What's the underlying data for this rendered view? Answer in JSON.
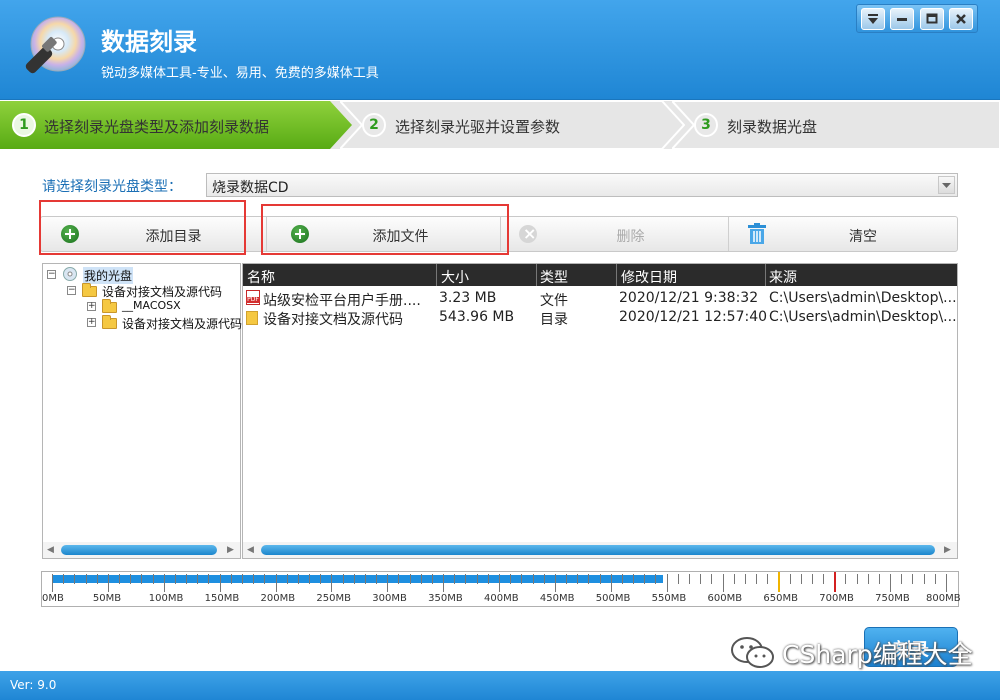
{
  "app": {
    "title": "数据刻录",
    "subtitle": "锐动多媒体工具-专业、易用、免费的多媒体工具"
  },
  "window_controls": [
    "menu-icon",
    "minimize-icon",
    "maximize-icon",
    "close-icon"
  ],
  "steps": [
    {
      "num": "1",
      "label": "选择刻录光盘类型及添加刻录数据",
      "active": true
    },
    {
      "num": "2",
      "label": "选择刻录光驱并设置参数",
      "active": false
    },
    {
      "num": "3",
      "label": "刻录数据光盘",
      "active": false
    }
  ],
  "disc_type": {
    "label": "请选择刻录光盘类型：",
    "value": "烧录数据CD"
  },
  "toolbar": {
    "add_dir": "添加目录",
    "add_file": "添加文件",
    "delete": "删除",
    "clear": "清空"
  },
  "tree": {
    "root": "我的光盘",
    "child": "设备对接文档及源代码",
    "grandchildren": [
      "__MACOSX",
      "设备对接文档及源代码"
    ]
  },
  "list": {
    "columns": [
      "名称",
      "大小",
      "类型",
      "修改日期",
      "来源"
    ],
    "rows": [
      {
        "name": "站级安检平台用户手册....",
        "size": "3.23 MB",
        "type": "文件",
        "date": "2020/12/21 9:38:32",
        "source": "C:\\Users\\admin\\Desktop\\...",
        "icon": "pdf-icon"
      },
      {
        "name": "设备对接文档及源代码",
        "size": "543.96 MB",
        "type": "目录",
        "date": "2020/12/21 12:57:40",
        "source": "C:\\Users\\admin\\Desktop\\...",
        "icon": "folder-icon"
      }
    ]
  },
  "capacity": {
    "labels": [
      "0MB",
      "50MB",
      "100MB",
      "150MB",
      "200MB",
      "250MB",
      "300MB",
      "350MB",
      "400MB",
      "450MB",
      "500MB",
      "550MB",
      "600MB",
      "650MB",
      "700MB",
      "750MB",
      "800MB"
    ],
    "used_mb": 547,
    "max_mb": 800,
    "markers": [
      {
        "mb": 650,
        "color": "#f0b400"
      },
      {
        "mb": 700,
        "color": "#d32020"
      }
    ]
  },
  "burn_button": "刻录",
  "watermark": "CSharp编程大全",
  "status": {
    "version": "Ver: 9.0"
  },
  "colors": {
    "header": "#2b91dc",
    "accent_green": "#6abf24",
    "link_blue": "#1b6fb5"
  }
}
